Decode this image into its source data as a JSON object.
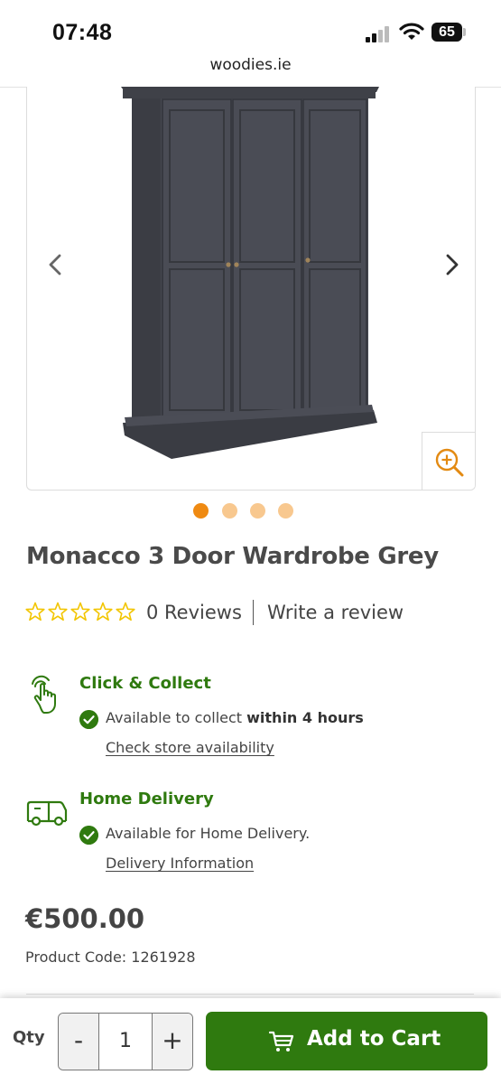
{
  "status_bar": {
    "time": "07:48",
    "battery": "65"
  },
  "browser": {
    "url": "woodies.ie"
  },
  "gallery": {
    "image_alt": "Monacco 3 Door Wardrobe Grey",
    "slide_count": 4,
    "active_slide": 1
  },
  "product": {
    "title": "Monacco 3 Door Wardrobe Grey",
    "rating": 0,
    "rating_max": 5,
    "reviews_label": "0 Reviews",
    "write_review_label": "Write a review",
    "price": "€500.00",
    "product_code": "Product Code: 1261928"
  },
  "click_collect": {
    "title": "Click & Collect",
    "availability_prefix": "Available to collect ",
    "availability_bold": "within 4 hours",
    "link": "Check store availability"
  },
  "home_delivery": {
    "title": "Home Delivery",
    "availability": "Available for Home Delivery.",
    "link": "Delivery Information"
  },
  "cart_bar": {
    "qty_label": "Qty",
    "minus_label": "-",
    "qty_value": "1",
    "plus_label": "+",
    "add_to_cart_label": "Add to Cart"
  },
  "colors": {
    "brand_green": "#2f7a0f",
    "star_yellow": "#f2c500",
    "active_dot": "#ef8a12",
    "inactive_dot": "#f8c88f",
    "zoom_orange": "#e38a12"
  },
  "icons": {
    "gallery_prev": "chevron-left-icon",
    "gallery_next": "chevron-right-icon",
    "zoom": "zoom-in-icon",
    "click_collect": "tap-hand-icon",
    "home_delivery": "delivery-truck-icon",
    "check": "check-circle-icon",
    "cart": "cart-icon"
  }
}
